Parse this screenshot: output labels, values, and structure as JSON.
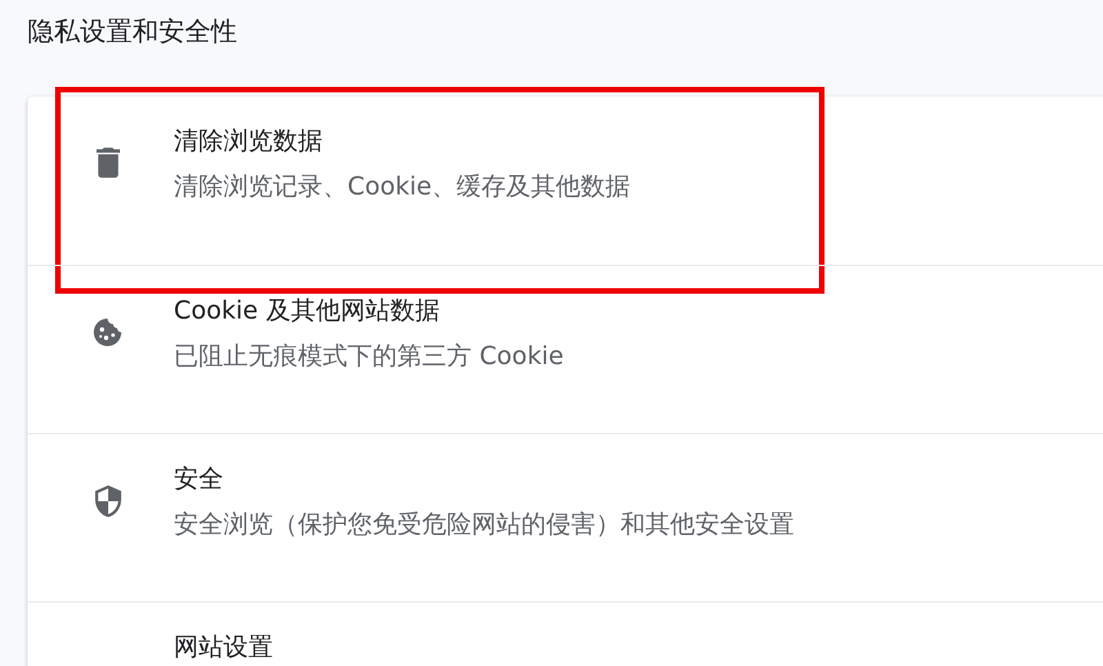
{
  "section_title": "隐私设置和安全性",
  "items": [
    {
      "title": "清除浏览数据",
      "subtitle": "清除浏览记录、Cookie、缓存及其他数据",
      "highlighted": true
    },
    {
      "title": "Cookie 及其他网站数据",
      "subtitle": "已阻止无痕模式下的第三方 Cookie",
      "highlighted": false
    },
    {
      "title": "安全",
      "subtitle": "安全浏览（保护您免受危险网站的侵害）和其他安全设置",
      "highlighted": false
    },
    {
      "title": "网站设置",
      "highlighted": false
    }
  ]
}
